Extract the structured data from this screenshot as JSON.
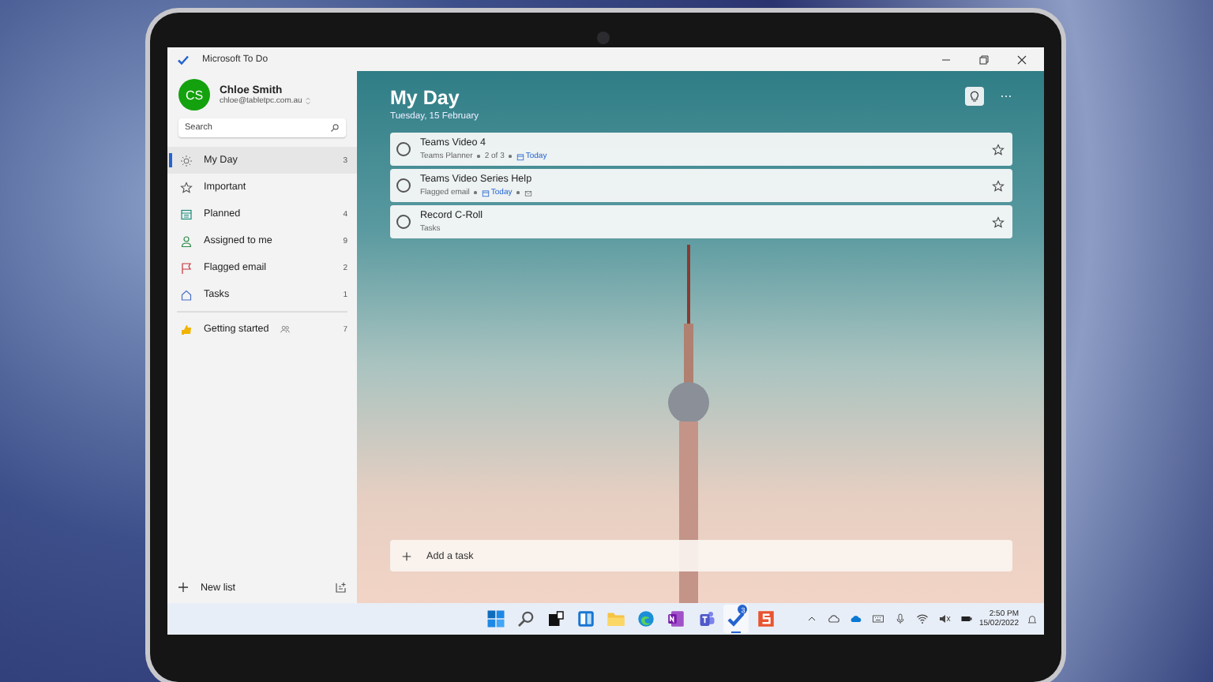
{
  "window": {
    "title": "Microsoft To Do"
  },
  "account": {
    "initials": "CS",
    "name": "Chloe Smith",
    "email": "chloe@tabletpc.com.au"
  },
  "search": {
    "placeholder": "Search"
  },
  "lists": [
    {
      "label": "My Day",
      "count": "3",
      "selected": true
    },
    {
      "label": "Important",
      "selected": false
    },
    {
      "label": "Planned",
      "count": "4",
      "selected": false
    },
    {
      "label": "Assigned to me",
      "count": "9",
      "selected": false
    },
    {
      "label": "Flagged email",
      "count": "2",
      "selected": false
    },
    {
      "label": "Tasks",
      "count": "1",
      "selected": false
    }
  ],
  "custom_lists": [
    {
      "label": "Getting started",
      "shared": true,
      "count": "7",
      "selected": false
    }
  ],
  "new_list": {
    "label": "New list"
  },
  "main": {
    "title": "My Day",
    "date": "Tuesday, 15 February"
  },
  "tasks": [
    {
      "title": "Teams Video 4",
      "completed": false,
      "starred": false,
      "meta": [
        {
          "kind": "text",
          "text": "Teams Planner"
        },
        {
          "kind": "text",
          "text": "2 of 3"
        },
        {
          "kind": "due",
          "text": "Today"
        }
      ]
    },
    {
      "title": "Teams Video Series Help",
      "completed": false,
      "starred": false,
      "meta": [
        {
          "kind": "text",
          "text": "Flagged email"
        },
        {
          "kind": "due",
          "text": "Today"
        },
        {
          "kind": "mail"
        }
      ]
    },
    {
      "title": "Record C-Roll",
      "completed": false,
      "starred": false,
      "meta": [
        {
          "kind": "text",
          "text": "Tasks"
        }
      ]
    }
  ],
  "add_task": {
    "placeholder": "Add a task"
  },
  "taskbar": {
    "apps": [
      {
        "kind": "windows",
        "active": false
      },
      {
        "kind": "search",
        "active": false
      },
      {
        "kind": "taskview",
        "active": false
      },
      {
        "kind": "widgets",
        "active": false
      },
      {
        "kind": "folder",
        "active": false
      },
      {
        "kind": "edge",
        "active": false
      },
      {
        "kind": "onenote",
        "active": false
      },
      {
        "kind": "teams",
        "active": false
      },
      {
        "kind": "todo",
        "active": true,
        "badge": "3"
      },
      {
        "kind": "sapp",
        "active": false
      }
    ],
    "time": "2:50 PM",
    "date": "15/02/2022"
  }
}
